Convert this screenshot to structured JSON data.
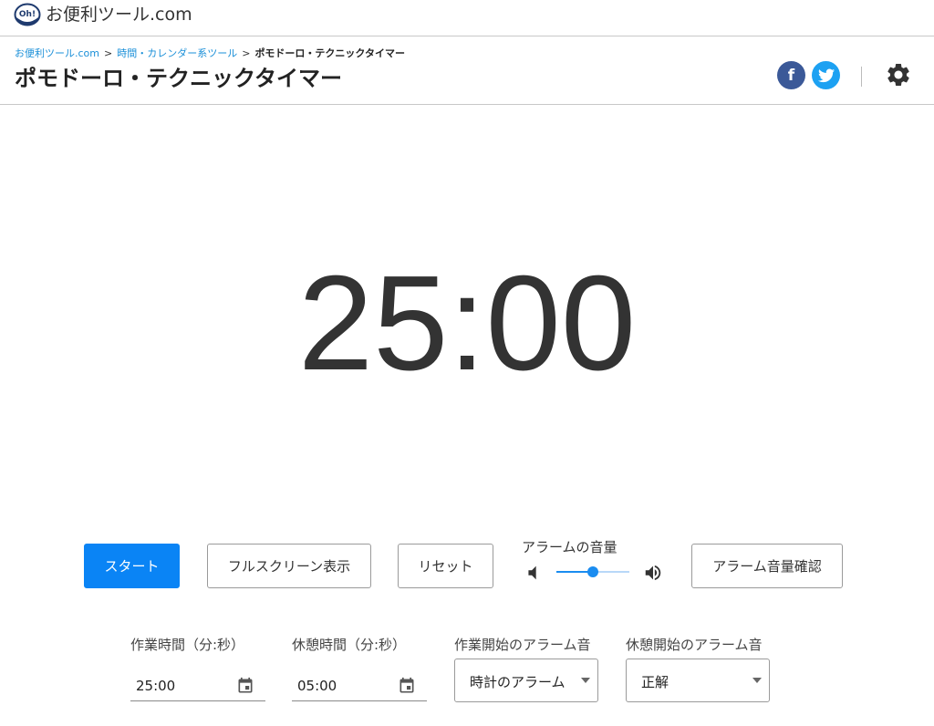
{
  "site": {
    "logo_text": "Oh!",
    "name": "お便利ツール.com"
  },
  "breadcrumb": {
    "items": [
      "お便利ツール.com",
      "時間・カレンダー系ツール"
    ],
    "separator": ">",
    "current": "ポモドーロ・テクニックタイマー"
  },
  "page": {
    "title": "ポモドーロ・テクニックタイマー"
  },
  "social": {
    "facebook_glyph": "f",
    "facebook_color": "#3b5998",
    "twitter_color": "#1da1f2"
  },
  "timer": {
    "display": "25:00"
  },
  "controls": {
    "start_label": "スタート",
    "start_color": "#0a84f5",
    "fullscreen_label": "フルスクリーン表示",
    "reset_label": "リセット",
    "volume_label": "アラームの音量",
    "volume_level": 0.5,
    "alarm_test_label": "アラーム音量確認"
  },
  "settings": {
    "work_time_label": "作業時間（分:秒）",
    "work_time_value": "25:00",
    "break_time_label": "休憩時間（分:秒）",
    "break_time_value": "05:00",
    "work_alarm_label": "作業開始のアラーム音",
    "work_alarm_value": "時計のアラーム",
    "break_alarm_label": "休憩開始のアラーム音",
    "break_alarm_value": "正解"
  }
}
